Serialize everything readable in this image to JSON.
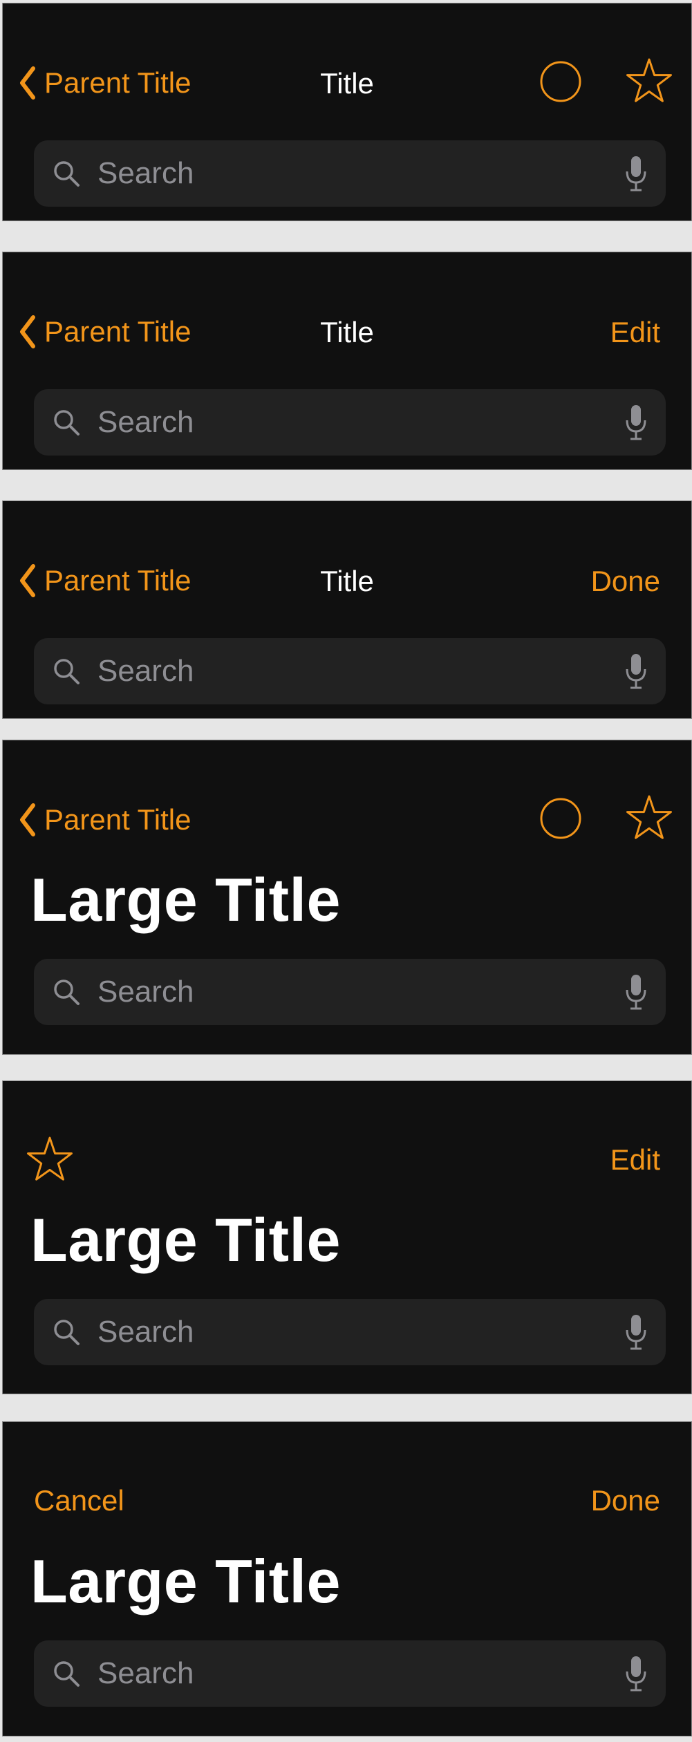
{
  "colors": {
    "accent": "#f2951a",
    "background": "#101010",
    "search_fill": "#222222",
    "placeholder": "#8e8e93"
  },
  "icons": {
    "back": "chevron-left-icon",
    "circle": "circle-icon",
    "star": "star-icon",
    "search": "magnifier-icon",
    "mic": "microphone-icon"
  },
  "panels": [
    {
      "back_label": "Parent Title",
      "title": "Title",
      "search_placeholder": "Search"
    },
    {
      "back_label": "Parent Title",
      "title": "Title",
      "right_label": "Edit",
      "search_placeholder": "Search"
    },
    {
      "back_label": "Parent Title",
      "title": "Title",
      "right_label": "Done",
      "search_placeholder": "Search"
    },
    {
      "back_label": "Parent Title",
      "large_title": "Large Title",
      "search_placeholder": "Search"
    },
    {
      "right_label": "Edit",
      "large_title": "Large Title",
      "search_placeholder": "Search"
    },
    {
      "left_label": "Cancel",
      "right_label": "Done",
      "large_title": "Large Title",
      "search_placeholder": "Search"
    }
  ]
}
